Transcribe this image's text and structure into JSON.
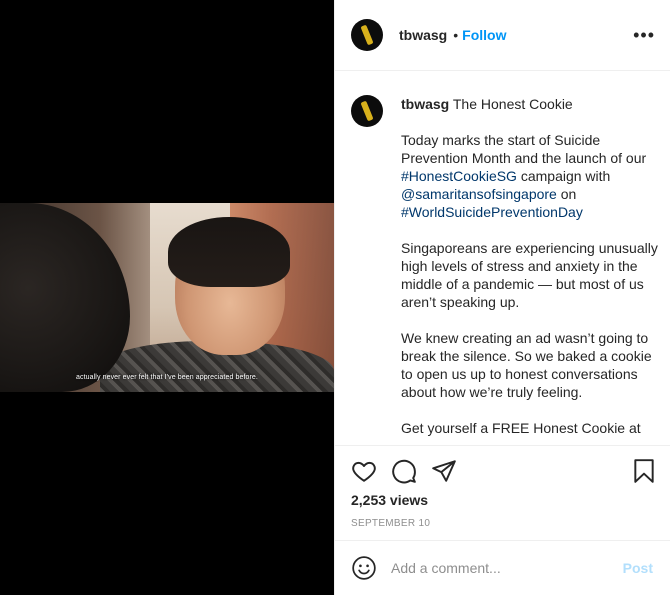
{
  "media": {
    "subtitle": "actually never ever felt that I've been appreciated before."
  },
  "header": {
    "username": "tbwasg",
    "separator": "•",
    "follow_label": "Follow",
    "more_label": "•••"
  },
  "caption": {
    "username": "tbwasg",
    "title": "The Honest Cookie",
    "p1_text1": "Today marks the start of Suicide Prevention Month and the launch of our ",
    "p1_tag1": "#HonestCookieSG",
    "p1_text2": " campaign with ",
    "p1_mention": "@samaritansofsingapore",
    "p1_text3": " on ",
    "p1_tag2": "#WorldSuicidePreventionDay",
    "p2": "Singaporeans are experiencing unusually high levels of stress and anxiety in the middle of a pandemic — but most of us aren’t speaking up.",
    "p3": "We knew creating an ad wasn’t going to break the silence. So we baked a cookie to open us up to honest conversations about how we’re truly feeling.",
    "p4": "Get yourself a FREE Honest Cookie at"
  },
  "stats": {
    "views": "2,253 views",
    "date": "SEPTEMBER 10"
  },
  "comment": {
    "placeholder": "Add a comment...",
    "post_label": "Post"
  },
  "colors": {
    "link": "#00376b",
    "follow": "#0095f6",
    "post_disabled": "#b2dffc",
    "muted": "#8e8e8e"
  },
  "icons": [
    "heart-icon",
    "comment-icon",
    "share-icon",
    "bookmark-icon",
    "emoji-icon"
  ]
}
